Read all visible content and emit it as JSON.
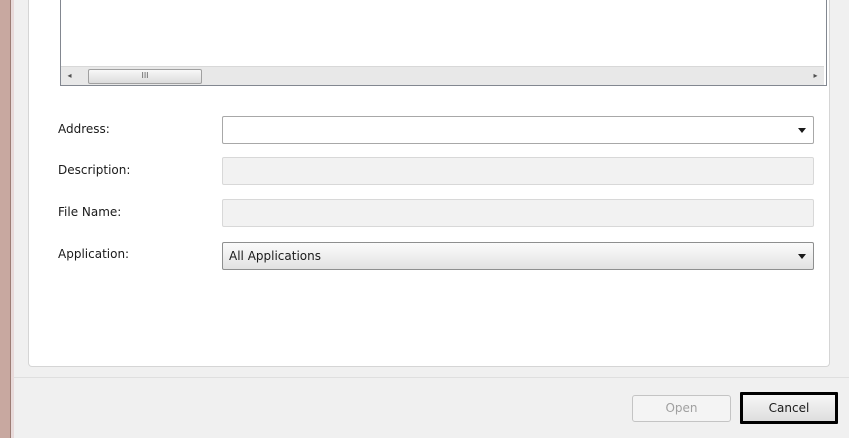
{
  "list": {
    "scroll_left_arrow": "◂",
    "scroll_thumb_grip": "III",
    "scroll_right_arrow": "▸"
  },
  "form": {
    "address": {
      "label": "Address:",
      "value": ""
    },
    "description": {
      "label": "Description:",
      "value": ""
    },
    "file_name": {
      "label": "File Name:",
      "value": ""
    },
    "application": {
      "label": "Application:",
      "value": "All Applications"
    }
  },
  "buttons": {
    "open": "Open",
    "cancel": "Cancel"
  },
  "colors": {
    "window_bg": "#f0f0f0",
    "panel_bg": "#ffffff",
    "frame_accent": "#c8a8a0",
    "focus_border": "#000000"
  }
}
